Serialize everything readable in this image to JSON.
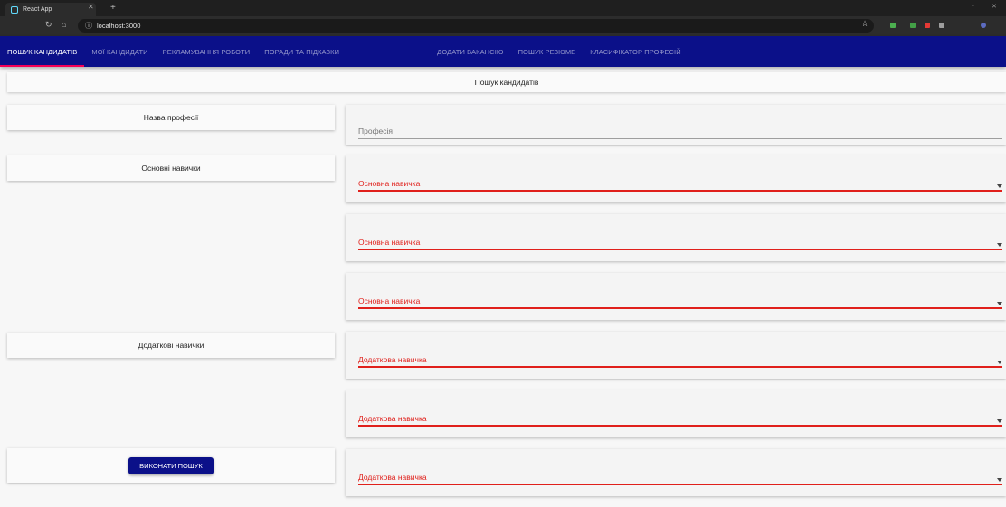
{
  "browser": {
    "tab_title": "React App",
    "url": "localhost:3000"
  },
  "appbar": {
    "tabs": [
      {
        "label": "ПОШУК КАНДИДАТІВ",
        "active": true
      },
      {
        "label": "МОЇ КАНДИДАТИ",
        "active": false
      },
      {
        "label": "РЕКЛАМУВАННЯ РОБОТИ",
        "active": false
      },
      {
        "label": "ПОРАДИ ТА ПІДКАЗКИ",
        "active": false
      },
      {
        "label": "ДОДАТИ ВАКАНСІЮ",
        "active": false
      },
      {
        "label": "ПОШУК РЕЗЮМЕ",
        "active": false
      },
      {
        "label": "КЛАСИФІКАТОР ПРОФЕСІЙ",
        "active": false
      }
    ]
  },
  "page": {
    "title": "Пошук кандидатів"
  },
  "form": {
    "profession_label": "Назва професії",
    "main_skills_label": "Основні навички",
    "extra_skills_label": "Додаткові навички",
    "submit_label": "ВИКОНАТИ ПОШУК",
    "profession_placeholder": "Професія",
    "main_skill_placeholder": "Основна навичка",
    "extra_skill_placeholder": "Додаткова навичка"
  },
  "colors": {
    "appbar": "#0b1089",
    "indicator": "#f50057",
    "error": "#e0201b"
  }
}
